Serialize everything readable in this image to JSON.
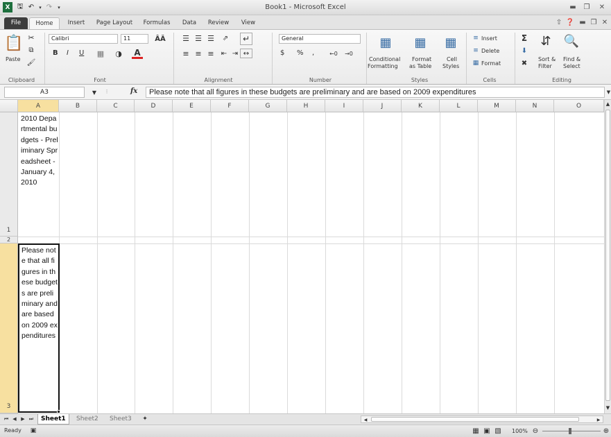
{
  "window": {
    "title": "Book1 - Microsoft Excel",
    "minimize_icon": "minimize-icon",
    "restore_icon": "restore-icon",
    "close_icon": "close-icon"
  },
  "ribbon_tabs": [
    "File",
    "Home",
    "Insert",
    "Page Layout",
    "Formulas",
    "Data",
    "Review",
    "View"
  ],
  "ribbon": {
    "clipboard": {
      "paste": "Paste",
      "label": "Clipboard"
    },
    "font": {
      "name": "Calibri",
      "size": "11",
      "label": "Font",
      "bold": "B",
      "italic": "I",
      "underline": "U"
    },
    "alignment": {
      "label": "Alignment"
    },
    "number": {
      "format": "General",
      "label": "Number",
      "currency": "$",
      "percent": "%",
      "comma": ","
    },
    "styles": {
      "conditional_line1": "Conditional",
      "conditional_line2": "Formatting",
      "format_line1": "Format",
      "format_line2": "as Table",
      "cell_line1": "Cell",
      "cell_line2": "Styles",
      "label": "Styles"
    },
    "cells": {
      "insert": "Insert",
      "delete": "Delete",
      "format": "Format",
      "label": "Cells"
    },
    "editing": {
      "sort_line1": "Sort &",
      "sort_line2": "Filter",
      "find_line1": "Find &",
      "find_line2": "Select",
      "label": "Editing"
    }
  },
  "formula_bar": {
    "name_box": "A3",
    "fx": "fx",
    "content": "Please note that all figures in these budgets are preliminary and are based on 2009 expenditures"
  },
  "columns": [
    "A",
    "B",
    "C",
    "D",
    "E",
    "F",
    "G",
    "H",
    "I",
    "J",
    "K",
    "L",
    "M",
    "N",
    "O"
  ],
  "rows": [
    "1",
    "2",
    "3"
  ],
  "cells": {
    "A1": "2010 Departmental budgets - Preliminary Spreadsheet - January 4, 2010",
    "A3": "Please note that all figures in these budgets are preliminary and are based on 2009 expenditures"
  },
  "sheets": [
    "Sheet1",
    "Sheet2",
    "Sheet3"
  ],
  "status": {
    "ready": "Ready",
    "zoom": "100%"
  }
}
